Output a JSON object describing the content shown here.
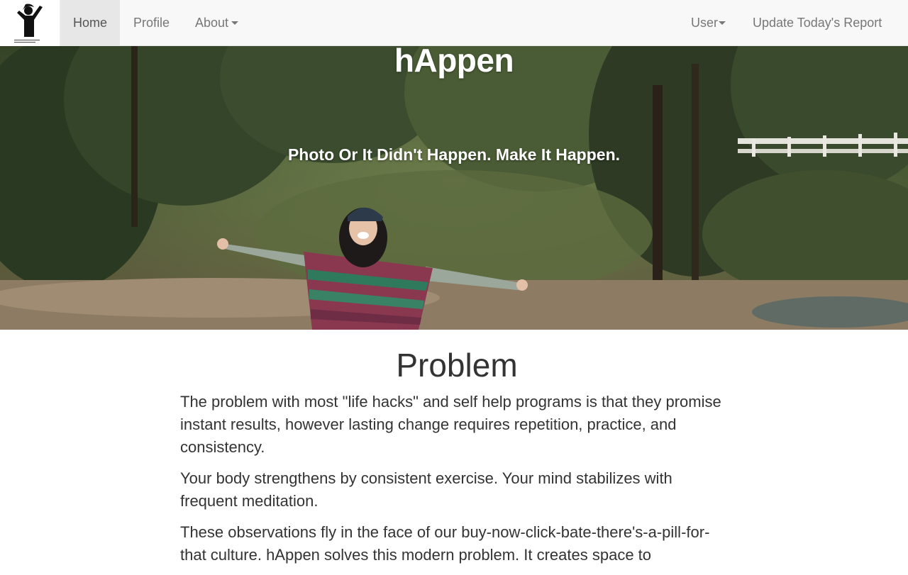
{
  "navbar": {
    "brand_icon": "person-cheering-logo-icon",
    "items": [
      {
        "label": "Home",
        "active": true
      },
      {
        "label": "Profile"
      },
      {
        "label": "About",
        "dropdown": true
      }
    ],
    "right_items": [
      {
        "label": "User",
        "dropdown": true
      },
      {
        "label": "Update Today's Report"
      }
    ]
  },
  "hero": {
    "title": "hAppen",
    "tagline": "Photo Or It Didn't Happen. Make It Happen."
  },
  "problem": {
    "heading": "Problem",
    "paragraphs": [
      "The problem with most \"life hacks\" and self help programs is that they promise instant results, however lasting change requires repetition, practice, and consistency.",
      "Your body strengthens by consistent exercise. Your mind stabilizes with frequent meditation.",
      "These observations fly in the face of our buy-now-click-bate-there's-a-pill-for-that culture. hAppen solves this modern problem. It creates space to"
    ]
  },
  "colors": {
    "navbar_bg": "#f8f8f8",
    "nav_text": "#777777",
    "active_bg": "#e7e7e7",
    "hero_text": "#ffffff"
  }
}
